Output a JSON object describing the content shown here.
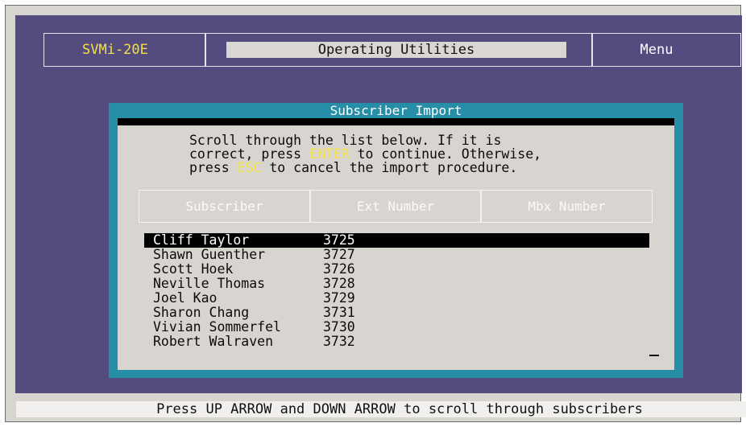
{
  "header": {
    "model": "SVMi-20E",
    "title": "Operating Utilities",
    "menu": "Menu"
  },
  "dialog": {
    "title": "Subscriber Import",
    "instructions": {
      "line1": "Scroll through the list below. If it is",
      "line2_before": "correct, press ",
      "enter_key": "ENTER",
      "line2_after": " to continue. Otherwise,",
      "line3_before": "press ",
      "esc_key": "ESC",
      "line3_after": " to cancel the import procedure."
    },
    "columns": [
      "Subscriber",
      "Ext Number",
      "Mbx Number"
    ],
    "rows": [
      {
        "name": "Cliff Taylor",
        "ext": "3725",
        "selected": true
      },
      {
        "name": "Shawn Guenther",
        "ext": "3727"
      },
      {
        "name": "Scott Hoek",
        "ext": "3726"
      },
      {
        "name": "Neville Thomas",
        "ext": "3728"
      },
      {
        "name": "Joel Kao",
        "ext": "3729"
      },
      {
        "name": "Sharon Chang",
        "ext": "3731"
      },
      {
        "name": "Vivian Sommerfel",
        "ext": "3730"
      },
      {
        "name": "Robert Walraven",
        "ext": "3732"
      }
    ]
  },
  "status": "Press UP ARROW and DOWN ARROW to scroll through subscribers",
  "colors": {
    "desktop": "#544b7f",
    "dialog_border": "#268ea6",
    "dialog_body": "#d8d4d0",
    "key_highlight": "#f6e44e",
    "model_text": "#f3e04a"
  }
}
